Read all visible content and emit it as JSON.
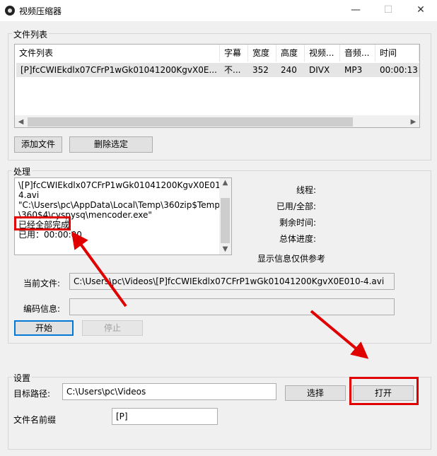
{
  "window": {
    "title": "视频压缩器",
    "minimize": "—",
    "maximize": "☐",
    "close": "✕"
  },
  "file_list": {
    "group_title": "文件列表",
    "columns": [
      "文件列表",
      "字幕",
      "宽度",
      "高度",
      "视频...",
      "音频...",
      "时间"
    ],
    "rows": [
      [
        "[P]fcCWIEkdlx07CFrP1wGk01041200KgvX0E...",
        "不...",
        "352",
        "240",
        "DIVX",
        "MP3",
        "00:00:13"
      ]
    ],
    "add_button": "添加文件",
    "delete_button": "删除选定"
  },
  "processing": {
    "group_title": "处理",
    "log_lines": [
      "\\[P]fcCWIEkdlx07CFrP1wGk01041200KgvX0E010-",
      "4.avi",
      "\"C:\\Users\\pc\\AppData\\Local\\Temp\\360zip$Temp",
      "\\360$4\\cyspysq\\mencoder.exe\"",
      "已经全部完成",
      "已用：00:00:00"
    ],
    "threads_label": "线程:",
    "used_total_label": "已用/全部:",
    "remaining_label": "剩余时间:",
    "overall_label": "总体进度:",
    "note": "显示信息仅供参考",
    "current_file_label": "当前文件:",
    "current_file_value": "C:\\Users\\pc\\Videos\\[P]fcCWIEkdlx07CFrP1wGk01041200KgvX0E010-4.avi",
    "encode_info_label": "编码信息:",
    "encode_info_value": "",
    "start_button": "开始",
    "stop_button": "停止"
  },
  "settings": {
    "group_title": "设置",
    "target_path_label": "目标路径:",
    "target_path_value": "C:\\Users\\pc\\Videos",
    "browse_button": "选择",
    "open_button": "打开",
    "prefix_label": "文件名前缀",
    "prefix_value": "[P]"
  },
  "annotation_color": "#e00000"
}
